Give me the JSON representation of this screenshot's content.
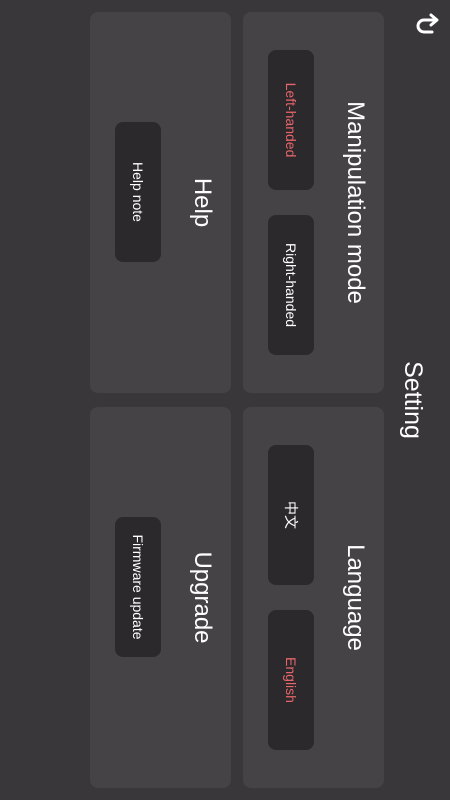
{
  "header": {
    "title": "Setting",
    "back_icon": "undo-arrow-icon"
  },
  "colors": {
    "background": "#393739",
    "card": "#454345",
    "button": "#2b292b",
    "active_text": "#e7666b",
    "text": "#ffffff"
  },
  "manipulation": {
    "title": "Manipulation mode",
    "left_label": "Left-handed",
    "right_label": "Right-handed",
    "selected": "Left-handed"
  },
  "language": {
    "title": "Language",
    "chinese_label": "中文",
    "english_label": "English",
    "selected": "English"
  },
  "help": {
    "title": "Help",
    "note_label": "Help note"
  },
  "upgrade": {
    "title": "Upgrade",
    "firmware_label": "Firmware update"
  }
}
